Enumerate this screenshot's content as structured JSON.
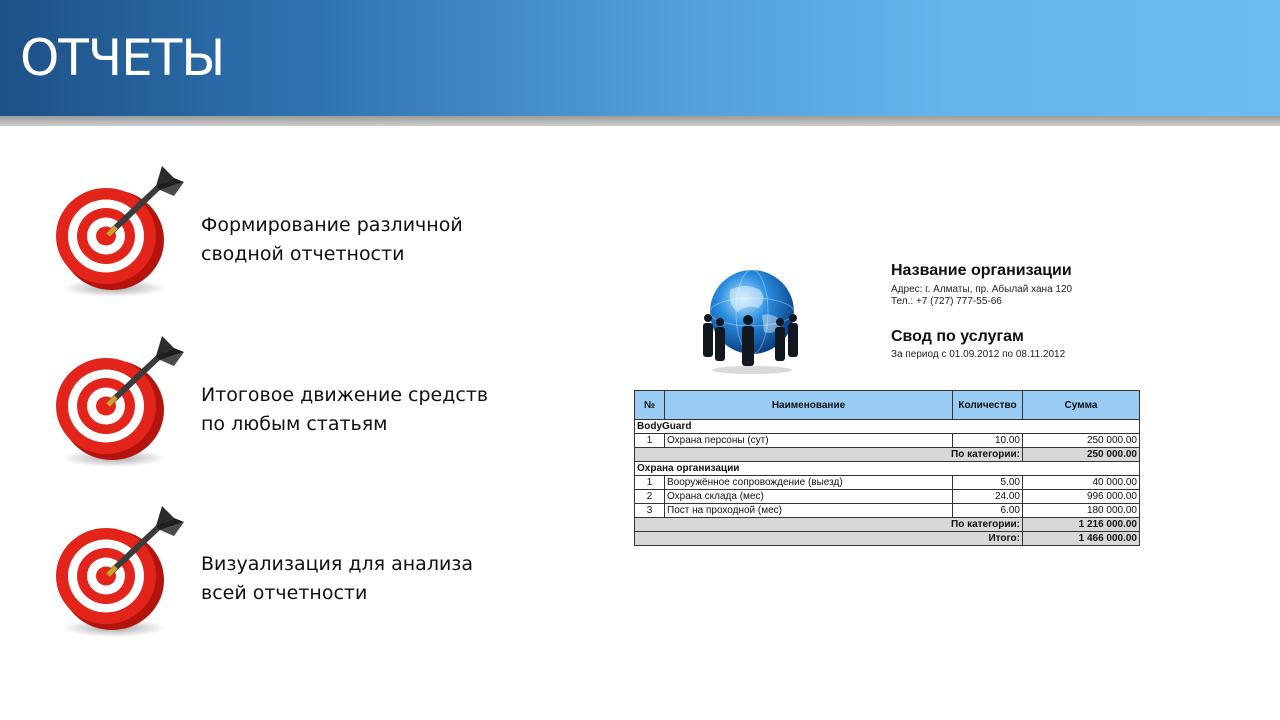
{
  "slide": {
    "title": "ОТЧЕТЫ"
  },
  "items": [
    {
      "line1": "Формирование различной",
      "line2": "сводной отчетности",
      "icon": "target-dart-icon"
    },
    {
      "line1": "Итоговое движение средств",
      "line2": "по любым статьям",
      "icon": "target-dart-icon"
    },
    {
      "line1": "Визуализация для анализа",
      "line2": "всей отчетности",
      "icon": "target-dart-icon"
    }
  ],
  "report": {
    "org_name": "Название организации",
    "address": "Адрес: г. Алматы, пр. Абылай хана 120",
    "phone": "Тел.: +7 (727) 777-55-66",
    "title": "Свод по услугам",
    "period": "За период с 01.09.2012 по 08.11.2012",
    "columns": [
      "№",
      "Наименование",
      "Количество",
      "Сумма"
    ],
    "categories": [
      {
        "name": "BodyGuard",
        "rows": [
          {
            "n": "1",
            "name": "Охрана персоны (сут)",
            "qty": "10.00",
            "sum": "250 000.00"
          }
        ],
        "subtotal_label": "По категории:",
        "subtotal": "250 000.00"
      },
      {
        "name": "Охрана организации",
        "rows": [
          {
            "n": "1",
            "name": "Вооружённое сопровождение (выезд)",
            "qty": "5.00",
            "sum": "40 000.00"
          },
          {
            "n": "2",
            "name": "Охрана склада (мес)",
            "qty": "24.00",
            "sum": "996 000.00"
          },
          {
            "n": "3",
            "name": "Пост на проходной (мес)",
            "qty": "6.00",
            "sum": "180 000.00"
          }
        ],
        "subtotal_label": "По категории:",
        "subtotal": "1 216 000.00"
      }
    ],
    "total_label": "Итого:",
    "total": "1 466 000.00"
  },
  "colors": {
    "accent_blue": "#4f9bd6",
    "target_red": "#e3241b",
    "table_header": "#99ccf5"
  }
}
